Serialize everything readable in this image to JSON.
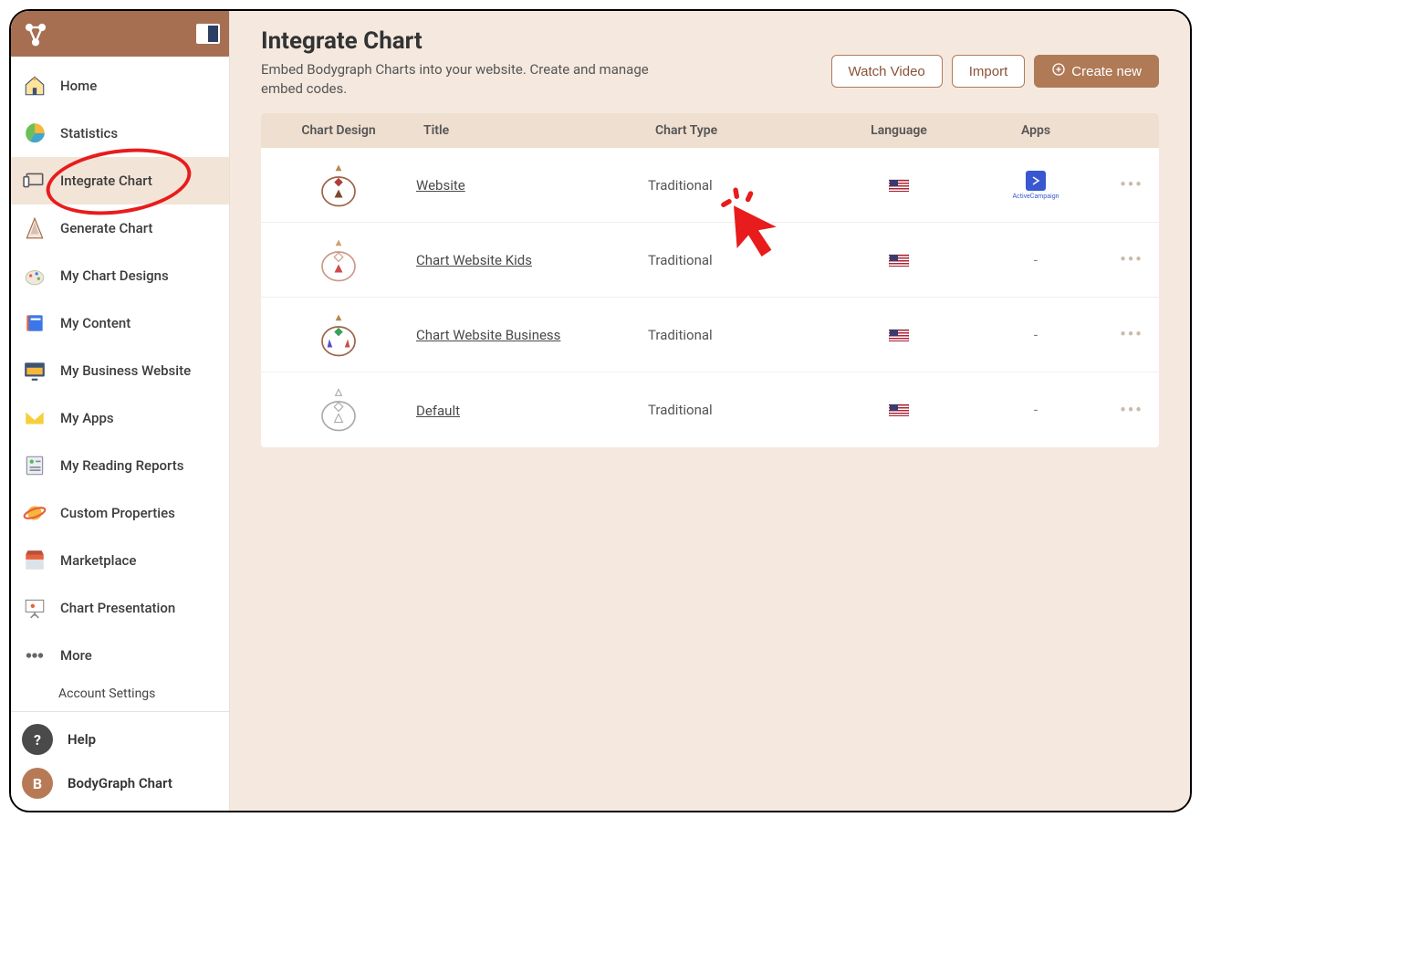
{
  "sidebar": {
    "items": [
      {
        "label": "Home"
      },
      {
        "label": "Statistics"
      },
      {
        "label": "Integrate Chart"
      },
      {
        "label": "Generate Chart"
      },
      {
        "label": "My Chart Designs"
      },
      {
        "label": "My Content"
      },
      {
        "label": "My Business Website"
      },
      {
        "label": "My Apps"
      },
      {
        "label": "My Reading Reports"
      },
      {
        "label": "Custom Properties"
      },
      {
        "label": "Marketplace"
      },
      {
        "label": "Chart Presentation"
      },
      {
        "label": "More"
      }
    ],
    "sub_item": "Account Settings",
    "footer": {
      "help_label": "Help",
      "account_label": "BodyGraph Chart",
      "account_initial": "B",
      "help_symbol": "?"
    }
  },
  "page": {
    "title": "Integrate Chart",
    "description": "Embed Bodygraph Charts into your website. Create and manage embed codes."
  },
  "actions": {
    "watch_video": "Watch Video",
    "import": "Import",
    "create_new": "Create new"
  },
  "table": {
    "headers": {
      "design": "Chart Design",
      "title": "Title",
      "type": "Chart Type",
      "language": "Language",
      "apps": "Apps"
    },
    "rows": [
      {
        "title": "Website",
        "type": "Traditional",
        "apps": "ActiveCampaign"
      },
      {
        "title": "Chart Website Kids",
        "type": "Traditional",
        "apps": "-"
      },
      {
        "title": "Chart Website Business",
        "type": "Traditional",
        "apps": "-"
      },
      {
        "title": "Default",
        "type": "Traditional",
        "apps": "-"
      }
    ]
  },
  "annotation": {
    "circled_item": "Integrate Chart",
    "cursor_target": "Website"
  }
}
